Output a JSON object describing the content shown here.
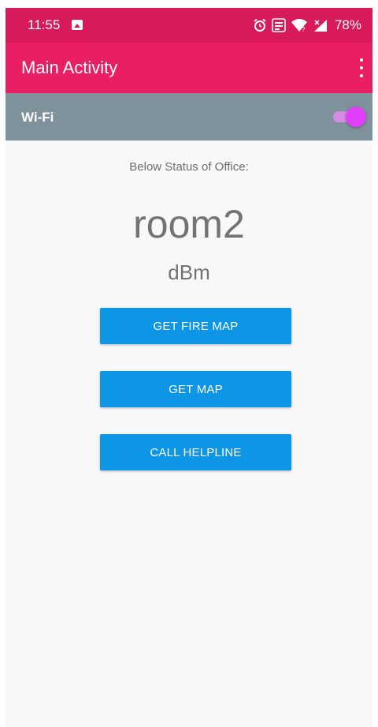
{
  "status_bar": {
    "time": "11:55",
    "battery": "78%",
    "icons": [
      "gallery-icon",
      "alarm-icon",
      "volte-icon",
      "wifi-icon",
      "signal-icon"
    ]
  },
  "app_bar": {
    "title": "Main Activity",
    "menu_icon": "overflow-menu-icon"
  },
  "wifi": {
    "label": "Wi-Fi",
    "enabled": true
  },
  "main": {
    "subtitle": "Below Status of Office:",
    "room": "room2",
    "unit": "dBm"
  },
  "buttons": {
    "fire_map": "GET FIRE MAP",
    "map": "GET MAP",
    "helpline": "CALL HELPLINE"
  },
  "colors": {
    "status_bar": "#d81a5a",
    "app_bar": "#e91e63",
    "wifi_bar": "#7f929b",
    "toggle_thumb": "#e040fb",
    "button": "#0d96e6"
  }
}
